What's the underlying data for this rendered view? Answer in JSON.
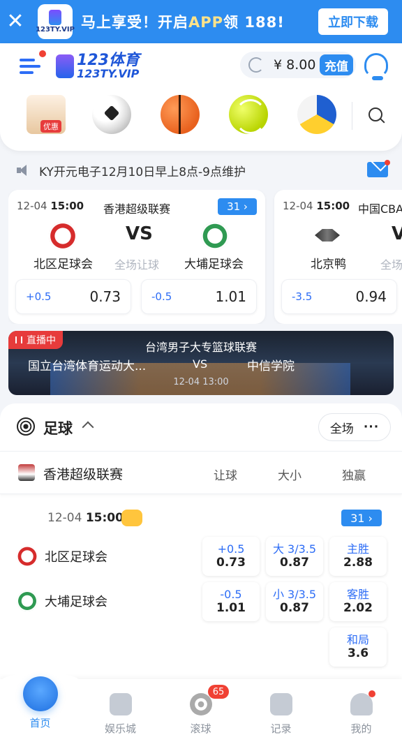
{
  "promo": {
    "message_pre": "马上享受！开启",
    "message_app": "APP",
    "message_mid": "领 ",
    "message_num": "188",
    "message_post": "!",
    "download_label": "立即下载",
    "app_logo_text": "123TY.VIP"
  },
  "header": {
    "brand_top": "123体育",
    "brand_bottom": "123TY.VIP",
    "balance": "¥ 8.00",
    "recharge_label": "充值"
  },
  "sport_icons": [
    {
      "name": "promo-gift-icon",
      "tag": "优惠"
    },
    {
      "name": "soccer-ball-icon"
    },
    {
      "name": "basketball-icon"
    },
    {
      "name": "tennis-ball-icon"
    },
    {
      "name": "volleyball-icon"
    }
  ],
  "notice": {
    "text": "KY开元电子12月10日早上8点-9点维护"
  },
  "cards": [
    {
      "date": "12-04",
      "time": "15:00",
      "league": "香港超级联赛",
      "count": "31",
      "home": "北区足球会",
      "away": "大埔足球会",
      "vs": "VS",
      "handicap_label": "全场让球",
      "odds": [
        {
          "h": "+0.5",
          "v": "0.73"
        },
        {
          "h": "-0.5",
          "v": "1.01"
        }
      ]
    },
    {
      "date": "12-04",
      "time": "15:00",
      "league": "中国CBA",
      "home": "北京鸭",
      "vs": "V",
      "handicap_label": "全场",
      "odds": [
        {
          "h": "-3.5",
          "v": "0.94"
        }
      ]
    }
  ],
  "live": {
    "tag": "直播中",
    "league": "台湾男子大专篮球联赛",
    "home": "国立台湾体育运动大...",
    "vs": "VS",
    "away": "中信学院",
    "datetime": "12-04 13:00"
  },
  "football": {
    "title": "足球",
    "filter_label": "全场",
    "filter_more": "···",
    "league": "香港超级联赛",
    "columns": [
      "让球",
      "大小",
      "独赢"
    ],
    "match": {
      "date": "12-04",
      "time": "15:00",
      "count": "31",
      "home": "北区足球会",
      "away": "大埔足球会",
      "home_odds": [
        {
          "h": "+0.5",
          "v": "0.73"
        },
        {
          "h": "大 3/3.5",
          "v": "0.87"
        },
        {
          "h": "主胜",
          "v": "2.88"
        }
      ],
      "away_odds": [
        {
          "h": "-0.5",
          "v": "1.01"
        },
        {
          "h": "小 3/3.5",
          "v": "0.87"
        },
        {
          "h": "客胜",
          "v": "2.02"
        }
      ],
      "draw": {
        "h": "和局",
        "v": "3.6"
      }
    }
  },
  "nav": [
    {
      "label": "首页",
      "active": true
    },
    {
      "label": "娱乐城"
    },
    {
      "label": "滚球",
      "badge": "65"
    },
    {
      "label": "记录"
    },
    {
      "label": "我的"
    }
  ],
  "colors": {
    "primary": "#2d8cf0",
    "live_red": "#e73b3b",
    "badge_red": "#f04134"
  }
}
